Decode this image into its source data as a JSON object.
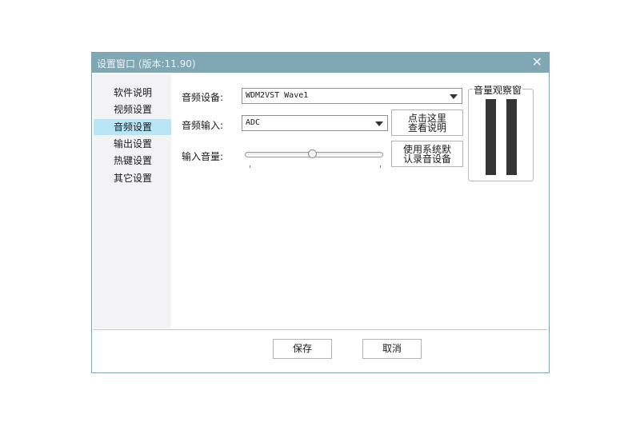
{
  "window": {
    "title": "设置窗口 (版本:11.90)",
    "close_glyph": "✕"
  },
  "sidebar": {
    "items": [
      {
        "label": "软件说明"
      },
      {
        "label": "视频设置"
      },
      {
        "label": "音频设置",
        "active": true
      },
      {
        "label": "输出设置"
      },
      {
        "label": "热键设置"
      },
      {
        "label": "其它设置"
      }
    ]
  },
  "audio": {
    "device_label": "音频设备:",
    "device_value": "WDM2VST Wave1",
    "input_label": "音频输入:",
    "input_value": "ADC",
    "volume_label": "输入音量:",
    "volume_level": 0.49,
    "help_button": {
      "line1": "点击这里",
      "line2": "查看说明"
    },
    "default_button": {
      "line1": "使用系统默",
      "line2": "认录音设备"
    }
  },
  "meter": {
    "title": "音量观察窗"
  },
  "footer": {
    "save_label": "保存",
    "cancel_label": "取消"
  },
  "colors": {
    "titlebar": "#80a7b4",
    "active_item": "#b9e6f7",
    "sidebar": "#f3f3f5",
    "meter_bar": "#353535"
  },
  "icons": {
    "close": "close-icon",
    "dropdown": "chevron-down-icon"
  }
}
